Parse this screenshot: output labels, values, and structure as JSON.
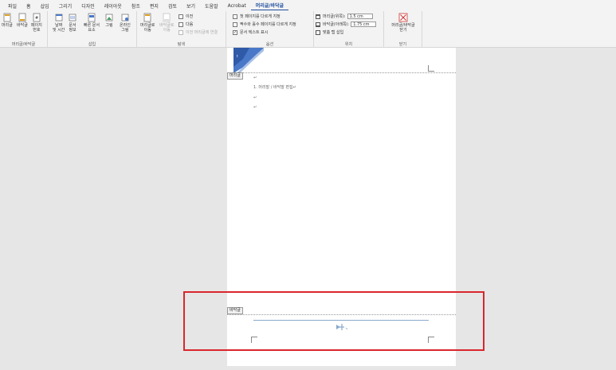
{
  "tabs": [
    "파일",
    "홈",
    "삽입",
    "그리기",
    "디자인",
    "레이아웃",
    "참조",
    "편지",
    "검토",
    "보기",
    "도움말",
    "Acrobat",
    "머리글/바닥글"
  ],
  "ribbon": {
    "group_header_footer": {
      "label": "머리글/바닥글",
      "header_btn": "머리글",
      "footer_btn": "바닥글",
      "page_num_btn": "페이지\n번호"
    },
    "group_insert": {
      "label": "삽입",
      "datetime_btn": "날짜\n및 시간",
      "docinfo_btn": "문서\n정보",
      "quickparts_btn": "빠른 문서\n요소",
      "picture_btn": "그림",
      "online_btn": "온라인\n그림"
    },
    "group_nav": {
      "label": "탐색",
      "goto_header_btn": "머리글로\n이동",
      "goto_footer_btn": "바닥글로\n이동",
      "prev": "이전",
      "next": "다음",
      "link_prev": "이전 머리글에 연결"
    },
    "group_options": {
      "label": "옵션",
      "first_page": "첫 페이지를 다르게 지정",
      "odd_even": "짝수와 홀수 페이지를 다르게 지정",
      "show_text": "문서 텍스트 표시"
    },
    "group_position": {
      "label": "위치",
      "header_pos_label": "머리글(위쪽):",
      "header_pos_value": "1.5 cm",
      "footer_pos_label": "바닥글(아래쪽):",
      "footer_pos_value": "1.75 cm",
      "align_tab": "맞춤 탭 삽입"
    },
    "group_close": {
      "label": "닫기",
      "close_btn": "머리글/바닥글\n닫기"
    }
  },
  "page": {
    "header_label": "머리글",
    "footer_label": "바닥글",
    "body_lines": [
      "↵",
      "1. 머리말 / 바닥말 편집↵",
      "↵",
      "↵"
    ]
  },
  "colors": {
    "accent": "#1f4e9e",
    "highlight": "#d9262c",
    "banner_blue": "#4a78c8"
  }
}
